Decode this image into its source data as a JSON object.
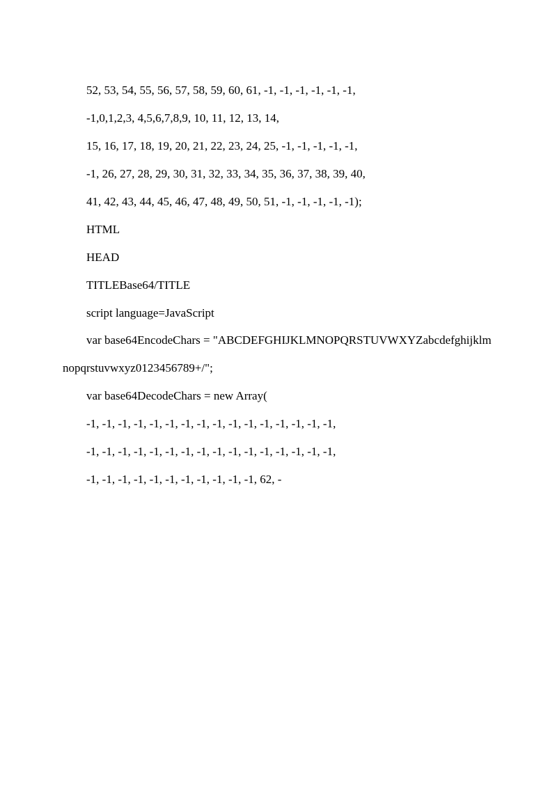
{
  "lines": [
    {
      "text": "　　52, 53, 54, 55, 56, 57, 58, 59, 60, 61, -1, -1, -1, -1, -1, -1,",
      "justify": false
    },
    {
      "text": "　　-1,0,1,2,3, 4,5,6,7,8,9, 10, 11, 12, 13, 14,",
      "justify": false
    },
    {
      "text": "　　15, 16, 17, 18, 19, 20, 21, 22, 23, 24, 25, -1, -1, -1, -1, -1,",
      "justify": false
    },
    {
      "text": "　　-1, 26, 27, 28, 29, 30, 31, 32, 33, 34, 35, 36, 37, 38, 39, 40,",
      "justify": false
    },
    {
      "text": "　　41, 42, 43, 44, 45, 46, 47, 48, 49, 50, 51, -1, -1, -1, -1, -1);",
      "justify": false
    },
    {
      "text": "　　HTML",
      "justify": false
    },
    {
      "text": "　　HEAD",
      "justify": false
    },
    {
      "text": "　　TITLEBase64/TITLE",
      "justify": false
    },
    {
      "text": "　　script language=JavaScript",
      "justify": false
    },
    {
      "text": "　　var base64EncodeChars = \"ABCDEFGHIJKLMNOPQRSTUVWXYZabcdefghijklmnopqrstuvwxyz0123456789+/\";",
      "justify": false
    },
    {
      "text": "　　var base64DecodeChars = new Array(",
      "justify": false
    },
    {
      "text": "　　-1, -1, -1, -1, -1, -1, -1, -1, -1, -1, -1, -1, -1, -1, -1, -1,",
      "justify": false
    },
    {
      "text": "　　-1, -1, -1, -1, -1, -1, -1, -1, -1, -1, -1, -1, -1, -1, -1, -1,",
      "justify": false
    },
    {
      "text": "　　-1, -1, -1, -1, -1, -1, -1, -1, -1, -1, -1, 62, -",
      "justify": false
    }
  ]
}
